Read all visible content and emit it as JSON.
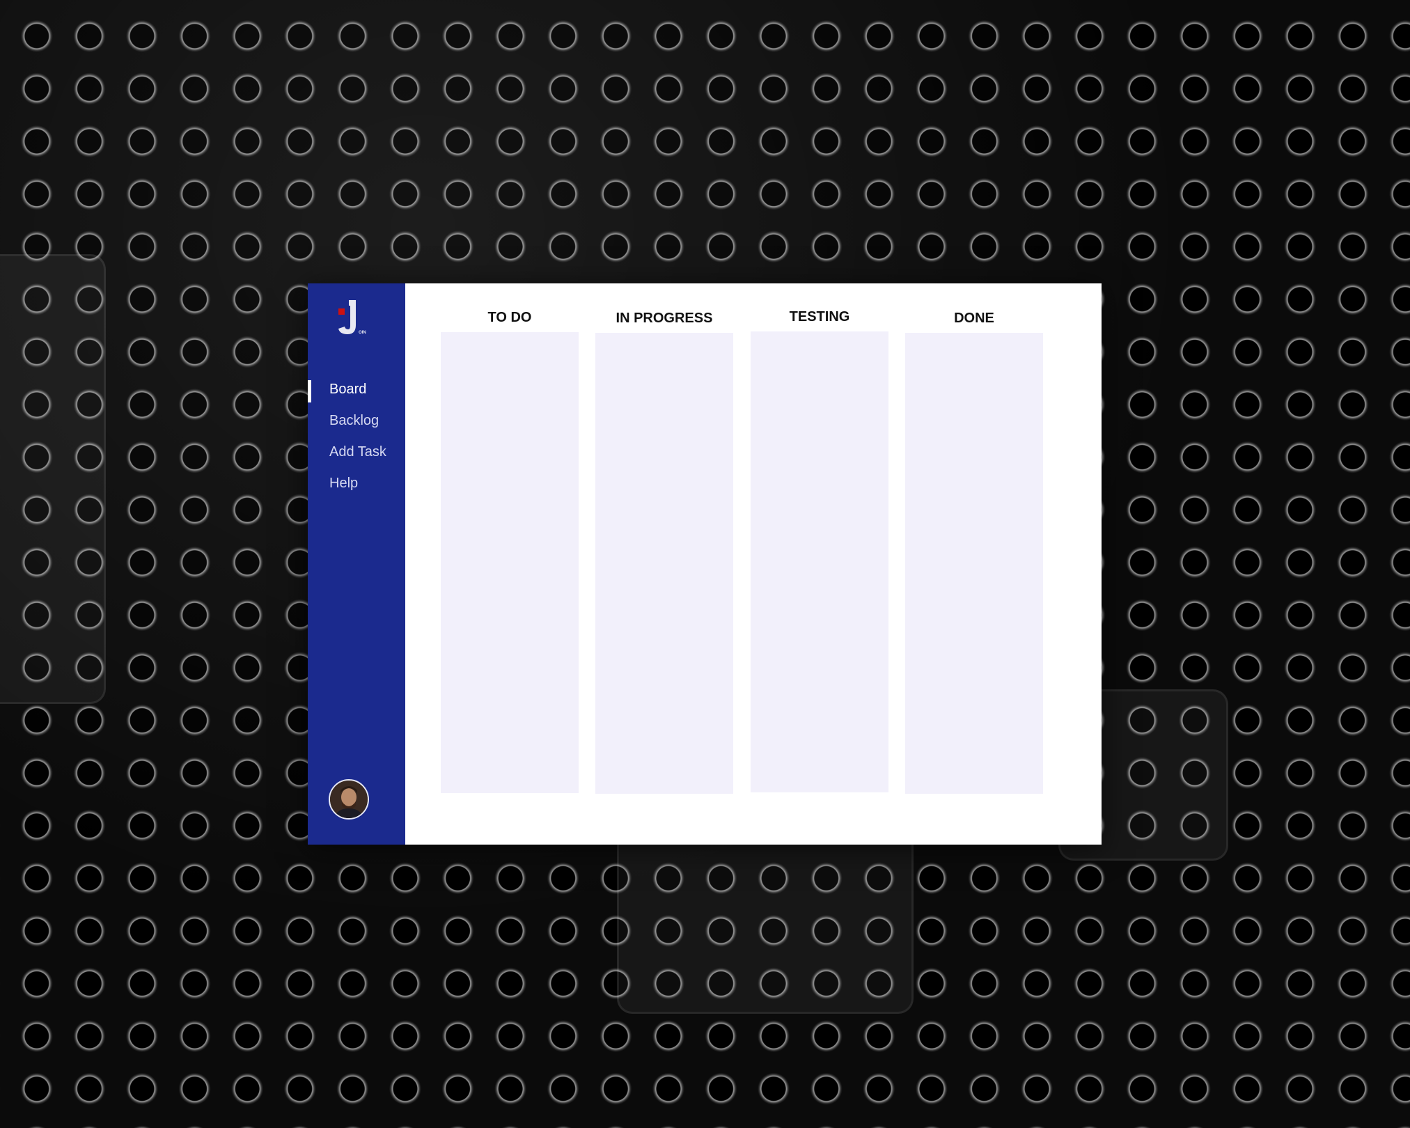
{
  "app": {
    "logo": {
      "icon": "join-logo-icon",
      "accent_color": "#cc1111"
    },
    "sidebar_color": "#1b2a8e"
  },
  "sidebar": {
    "items": [
      {
        "label": "Board",
        "active": true
      },
      {
        "label": "Backlog",
        "active": false
      },
      {
        "label": "Add Task",
        "active": false
      },
      {
        "label": "Help",
        "active": false
      }
    ],
    "avatar": {
      "icon": "user-avatar-icon"
    }
  },
  "board": {
    "columns": [
      {
        "title": "TO DO"
      },
      {
        "title": "IN PROGRESS"
      },
      {
        "title": "TESTING"
      },
      {
        "title": "DONE"
      }
    ],
    "column_color": "#f2f0fb"
  }
}
